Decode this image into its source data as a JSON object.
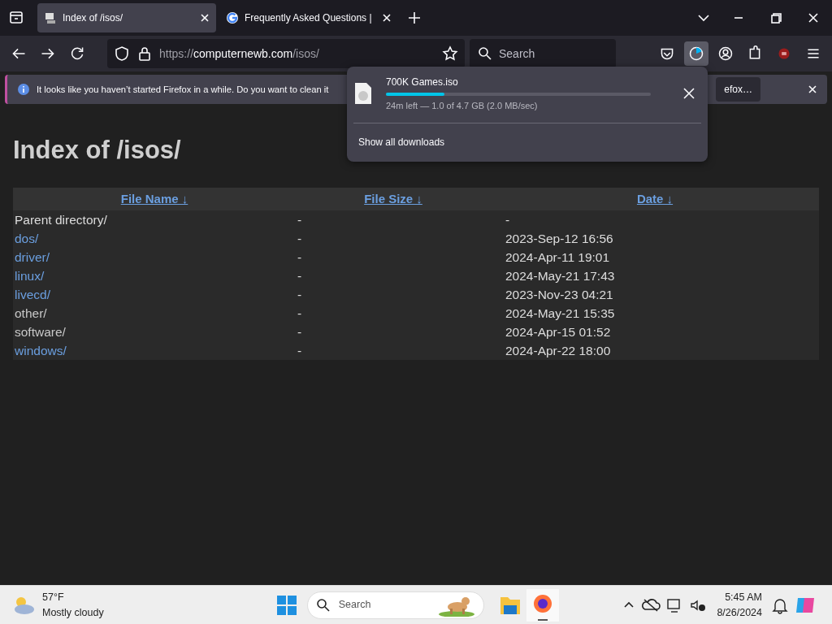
{
  "tabs": [
    {
      "title": "Index of /isos/",
      "selected": true
    },
    {
      "title": "Frequently Asked Questions |",
      "selected": false
    }
  ],
  "toolbar": {
    "url_scheme": "https://",
    "url_host": "computernewb.com",
    "url_path": "/isos/",
    "search_placeholder": "Search"
  },
  "notification": {
    "message": "It looks like you haven’t started Firefox in a while. Do you want to clean it",
    "button": "efox…"
  },
  "downloads_panel": {
    "file": "700K Games.iso",
    "level": 0.22,
    "status": "24m left — 1.0 of 4.7 GB (2.0 MB/sec)",
    "show_all": "Show all downloads"
  },
  "page": {
    "heading": "Index of /isos/",
    "columns": [
      {
        "label": "File Name",
        "arrow": "↓"
      },
      {
        "label": "File Size",
        "arrow": "↓"
      },
      {
        "label": "Date",
        "arrow": "↓"
      }
    ],
    "rows": [
      {
        "name": "Parent directory/",
        "kind": "plain",
        "size": "-",
        "date": "-"
      },
      {
        "name": "dos/",
        "kind": "link",
        "size": "-",
        "date": "2023-Sep-12 16:56"
      },
      {
        "name": "driver/",
        "kind": "link",
        "size": "-",
        "date": "2024-Apr-11 19:01"
      },
      {
        "name": "linux/",
        "kind": "link",
        "size": "-",
        "date": "2024-May-21 17:43"
      },
      {
        "name": "livecd/",
        "kind": "link",
        "size": "-",
        "date": "2023-Nov-23 04:21"
      },
      {
        "name": "other/",
        "kind": "visited",
        "size": "-",
        "date": "2024-May-21 15:35"
      },
      {
        "name": "software/",
        "kind": "visited",
        "size": "-",
        "date": "2024-Apr-15 01:52"
      },
      {
        "name": "windows/",
        "kind": "link",
        "size": "-",
        "date": "2024-Apr-22 18:00"
      }
    ]
  },
  "taskbar": {
    "temperature": "57°F",
    "weather": "Mostly cloudy",
    "search_placeholder": "Search",
    "time": "5:45 AM",
    "date": "8/26/2024"
  }
}
